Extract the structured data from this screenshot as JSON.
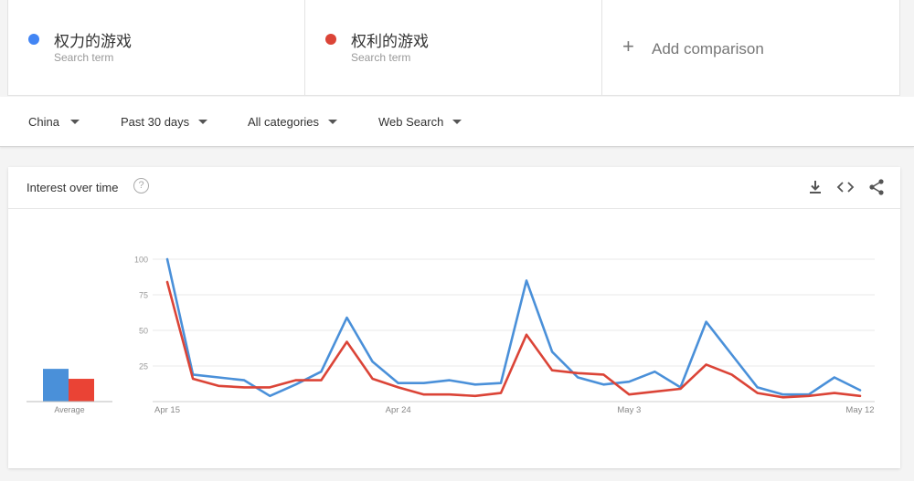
{
  "terms": [
    {
      "name": "权力的游戏",
      "sub": "Search term",
      "color": "#4285f4"
    },
    {
      "name": "权利的游戏",
      "sub": "Search term",
      "color": "#db4437"
    }
  ],
  "add_comparison": "Add comparison",
  "filters": [
    {
      "label": "China"
    },
    {
      "label": "Past 30 days"
    },
    {
      "label": "All categories"
    },
    {
      "label": "Web Search"
    }
  ],
  "card": {
    "title": "Interest over time",
    "help_icon": "question-icon",
    "icons": [
      "download-icon",
      "embed-icon",
      "share-icon"
    ]
  },
  "chart_data": {
    "type": "line",
    "title": "",
    "ylim": [
      0,
      100
    ],
    "yticks": [
      25,
      50,
      75,
      100
    ],
    "xtick_labels": [
      "Apr 15",
      "Apr 24",
      "May 3",
      "May 12"
    ],
    "xtick_positions": [
      0,
      9,
      18,
      27
    ],
    "grid": true,
    "average_label": "Average",
    "averages": [
      23,
      16
    ],
    "series": [
      {
        "name": "权力的游戏",
        "color": "#4a90d9",
        "values": [
          100,
          19,
          17,
          15,
          4,
          12,
          21,
          59,
          28,
          13,
          13,
          15,
          12,
          13,
          85,
          35,
          17,
          12,
          14,
          21,
          10,
          56,
          33,
          10,
          5,
          5,
          17,
          8
        ]
      },
      {
        "name": "权利的游戏",
        "color": "#db4437",
        "values": [
          84,
          16,
          11,
          10,
          10,
          15,
          15,
          42,
          16,
          10,
          5,
          5,
          4,
          6,
          47,
          22,
          20,
          19,
          5,
          7,
          9,
          26,
          19,
          6,
          3,
          4,
          6,
          4
        ]
      }
    ]
  }
}
